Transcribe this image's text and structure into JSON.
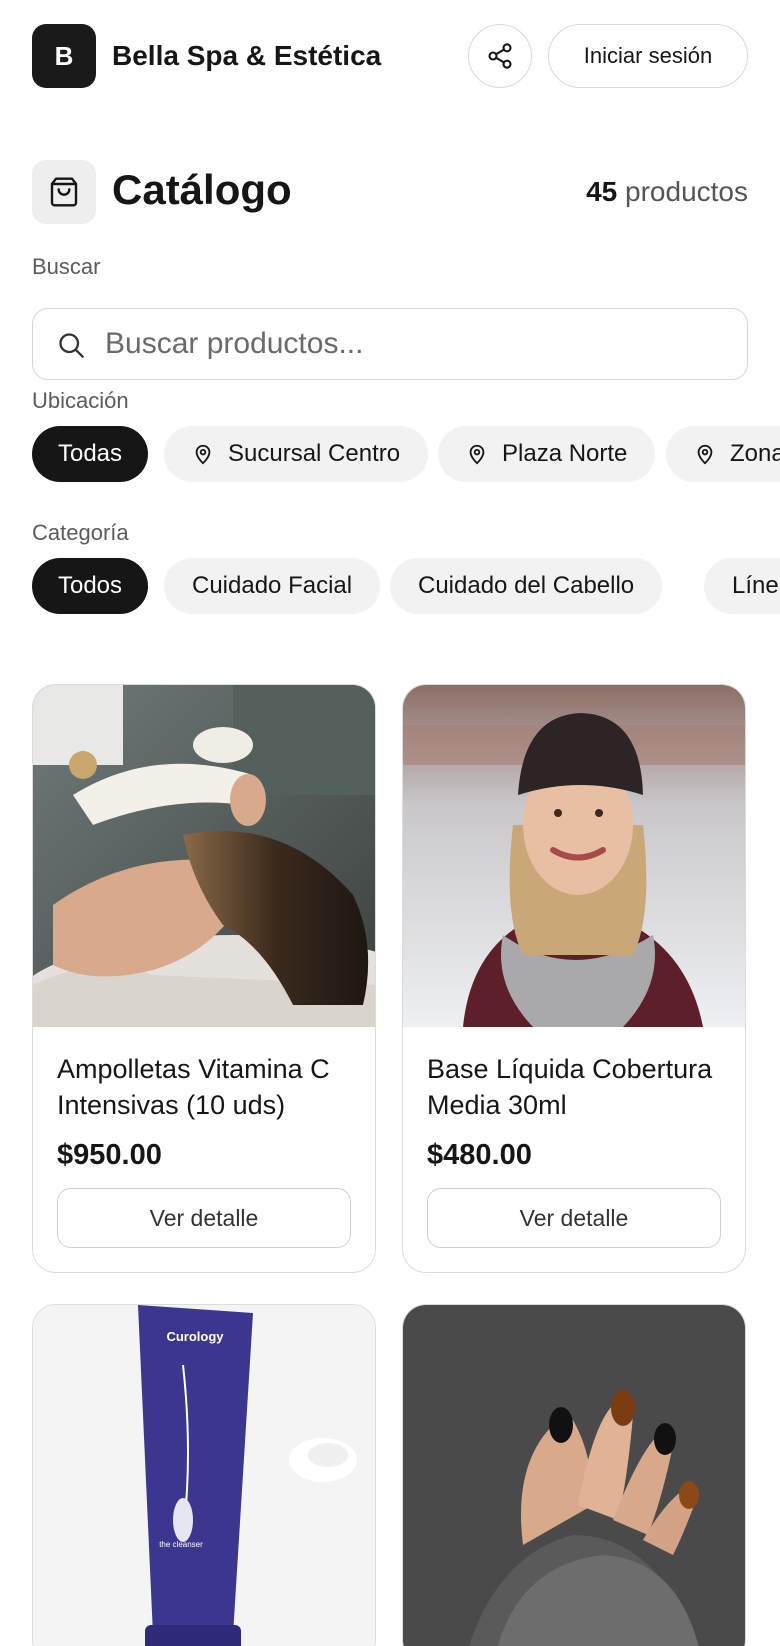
{
  "header": {
    "logo_letter": "B",
    "brand_name": "Bella Spa & Estética",
    "login_label": "Iniciar sesión"
  },
  "catalog": {
    "title": "Catálogo",
    "count_number": "45",
    "count_suffix": "productos"
  },
  "search": {
    "label": "Buscar",
    "placeholder": "Buscar productos..."
  },
  "location": {
    "label": "Ubicación",
    "chips": [
      "Todas",
      "Sucursal Centro",
      "Plaza Norte",
      "Zona"
    ],
    "selected": "Todas"
  },
  "category": {
    "label": "Categoría",
    "chips": [
      "Todos",
      "Cuidado Facial",
      "Cuidado del Cabello",
      "Línea"
    ],
    "selected": "Todos"
  },
  "products": [
    {
      "name": "Ampolletas Vitamina C Intensivas (10 uds)",
      "price": "$950.00",
      "button": "Ver detalle",
      "image": "facial-treatment-photo"
    },
    {
      "name": "Base Líquida Cobertura Media 30ml",
      "price": "$480.00",
      "button": "Ver detalle",
      "image": "woman-winter-beanie-photo"
    },
    {
      "name": "",
      "price": "",
      "button": "",
      "image": "cleanser-tube-photo",
      "tube_brand": "Curology",
      "tube_text": "the cleanser"
    },
    {
      "name": "",
      "price": "",
      "button": "",
      "image": "manicure-nails-photo"
    }
  ],
  "colors": {
    "primary": "#161616",
    "chip_bg": "#f2f2f2",
    "border": "#d9d9d9",
    "tube": "#3b3791"
  }
}
